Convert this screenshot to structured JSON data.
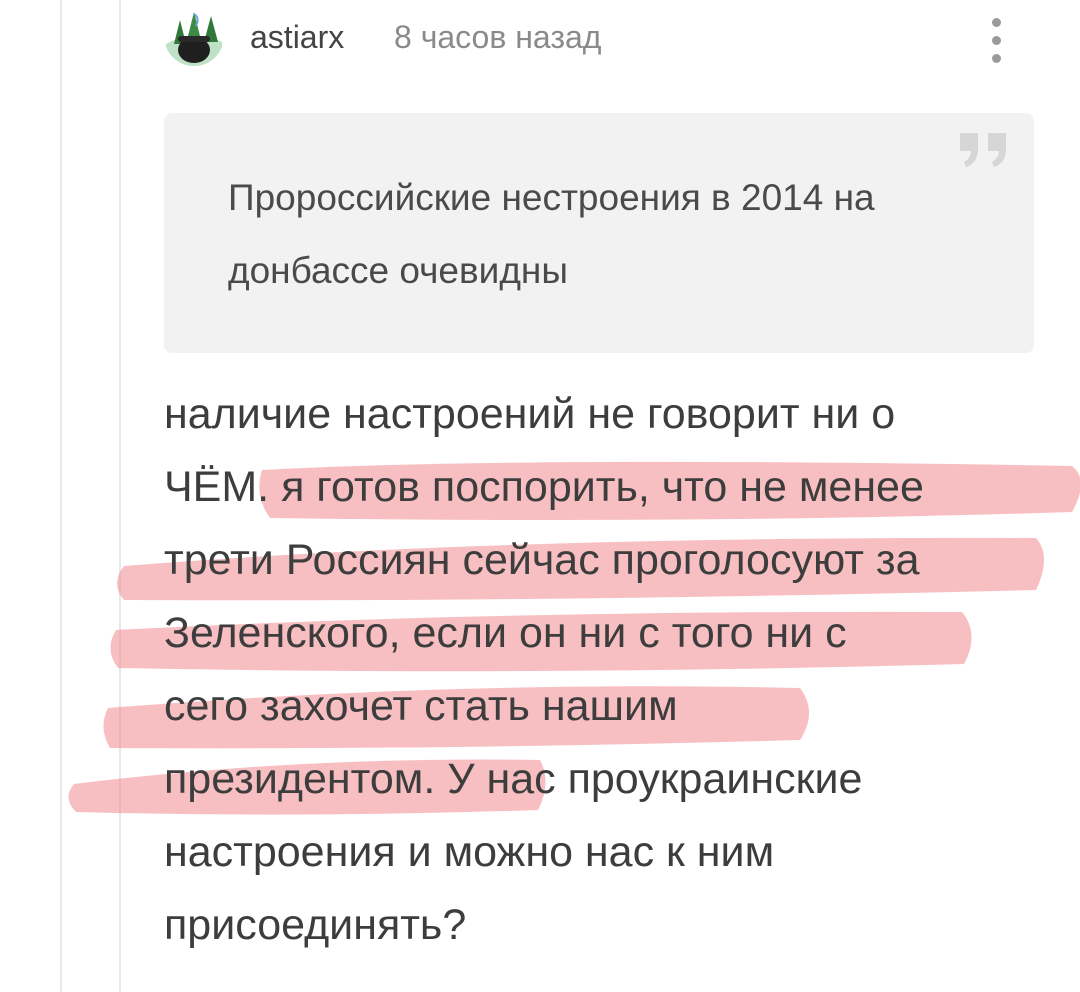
{
  "comment": {
    "author": "astiarx",
    "time": "8 часов назад",
    "quote_lines": [
      "Пророссийские нестроения в 2014 на",
      "донбассе очевидны"
    ],
    "body_lines": [
      "наличие настроений не говорит ни о",
      "ЧЁМ. я готов поспорить, что не менее",
      "трети Россиян сейчас проголосуют за",
      "Зеленского, если он ни с того ни с",
      "сего захочет стать нашим",
      "президентом. У нас проукраинские",
      "настроения и можно нас к ним",
      "присоединять?"
    ]
  },
  "icons": {
    "avatar": "avatar-forest-pot-icon",
    "more": "more-vertical-icon",
    "quote": "quote-mark-icon"
  },
  "colors": {
    "highlight": "#f08a8e",
    "quote_bg": "#f2f2f2",
    "thread_line": "#e7e7e7",
    "meta_text": "#8a8a8a"
  }
}
